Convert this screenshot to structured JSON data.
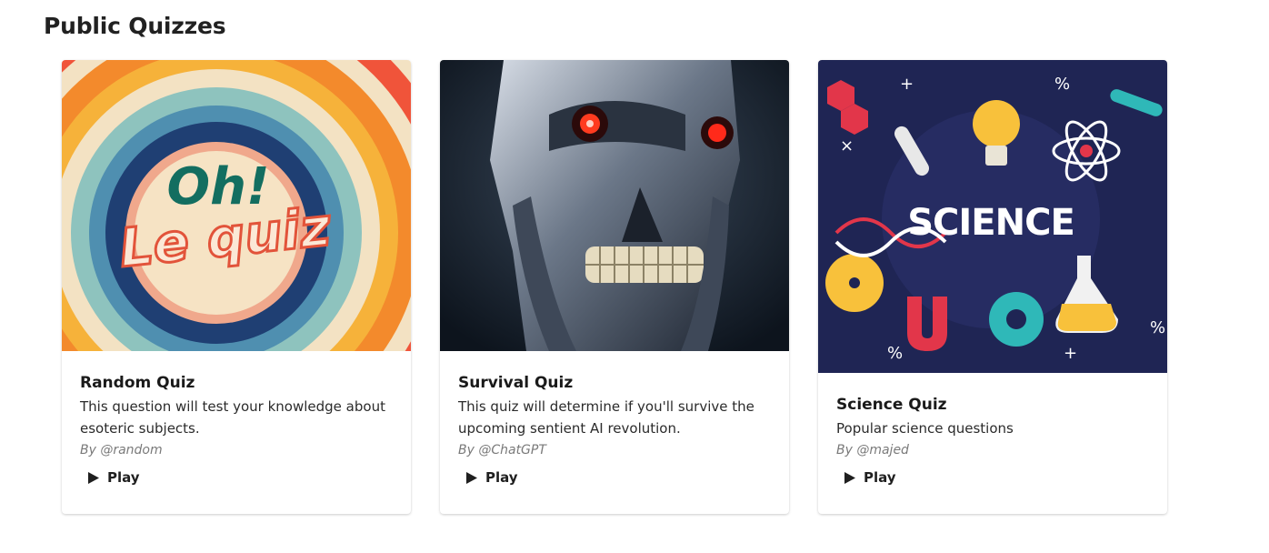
{
  "page": {
    "title": "Public Quizzes"
  },
  "quizzes": [
    {
      "title": "Random Quiz",
      "description": "This question will test your knowledge about esoteric subjects.",
      "author": "By @random",
      "play_label": "Play",
      "image_text_1": "Oh!",
      "image_text_2": "Le quiz"
    },
    {
      "title": "Survival Quiz",
      "description": "This quiz will determine if you'll survive the upcoming sentient AI revolution.",
      "author": "By @ChatGPT",
      "play_label": "Play"
    },
    {
      "title": "Science Quiz",
      "description": "Popular science questions",
      "author": "By @majed",
      "play_label": "Play",
      "image_text_1": "SCIENCE"
    }
  ],
  "icons": {
    "play": "play-icon"
  }
}
